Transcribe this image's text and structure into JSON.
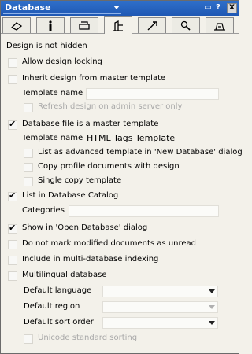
{
  "window": {
    "title": "Database",
    "help_glyph": "?",
    "close_glyph": "X",
    "menu_glyph": "▭"
  },
  "tabs": [
    {
      "icon": "eraser-icon"
    },
    {
      "icon": "info-icon"
    },
    {
      "icon": "printer-icon"
    },
    {
      "icon": "design-icon",
      "active": true
    },
    {
      "icon": "launch-icon"
    },
    {
      "icon": "search-icon"
    },
    {
      "icon": "advanced-icon"
    }
  ],
  "status": "Design is not hidden",
  "options": {
    "allow_locking": {
      "label": "Allow design locking",
      "checked": false
    },
    "inherit": {
      "label": "Inherit design from master template",
      "checked": false
    },
    "template_name_1": {
      "label": "Template name",
      "value": ""
    },
    "refresh": {
      "label": "Refresh design on admin server only",
      "checked": false,
      "disabled": true
    },
    "master_template": {
      "label": "Database file is a master template",
      "checked": true
    },
    "template_name_2": {
      "label": "Template name",
      "value": "HTML Tags Template"
    },
    "advanced_template": {
      "label": "List as advanced template in 'New Database' dialog",
      "checked": false
    },
    "copy_profile": {
      "label": "Copy profile documents with design",
      "checked": false
    },
    "single_copy": {
      "label": "Single copy template",
      "checked": false
    },
    "list_catalog": {
      "label": "List in Database Catalog",
      "checked": true
    },
    "categories": {
      "label": "Categories",
      "value": ""
    },
    "show_open": {
      "label": "Show in 'Open Database' dialog",
      "checked": true
    },
    "no_unread": {
      "label": "Do not mark modified documents as unread",
      "checked": false
    },
    "multi_index": {
      "label": "Include in multi-database indexing",
      "checked": false
    },
    "multilingual": {
      "label": "Multilingual database",
      "checked": false
    },
    "default_language": {
      "label": "Default language",
      "value": ""
    },
    "default_region": {
      "label": "Default region",
      "value": ""
    },
    "default_sort": {
      "label": "Default sort order",
      "value": ""
    },
    "unicode_sort": {
      "label": "Unicode standard sorting",
      "checked": false,
      "disabled": true
    }
  }
}
